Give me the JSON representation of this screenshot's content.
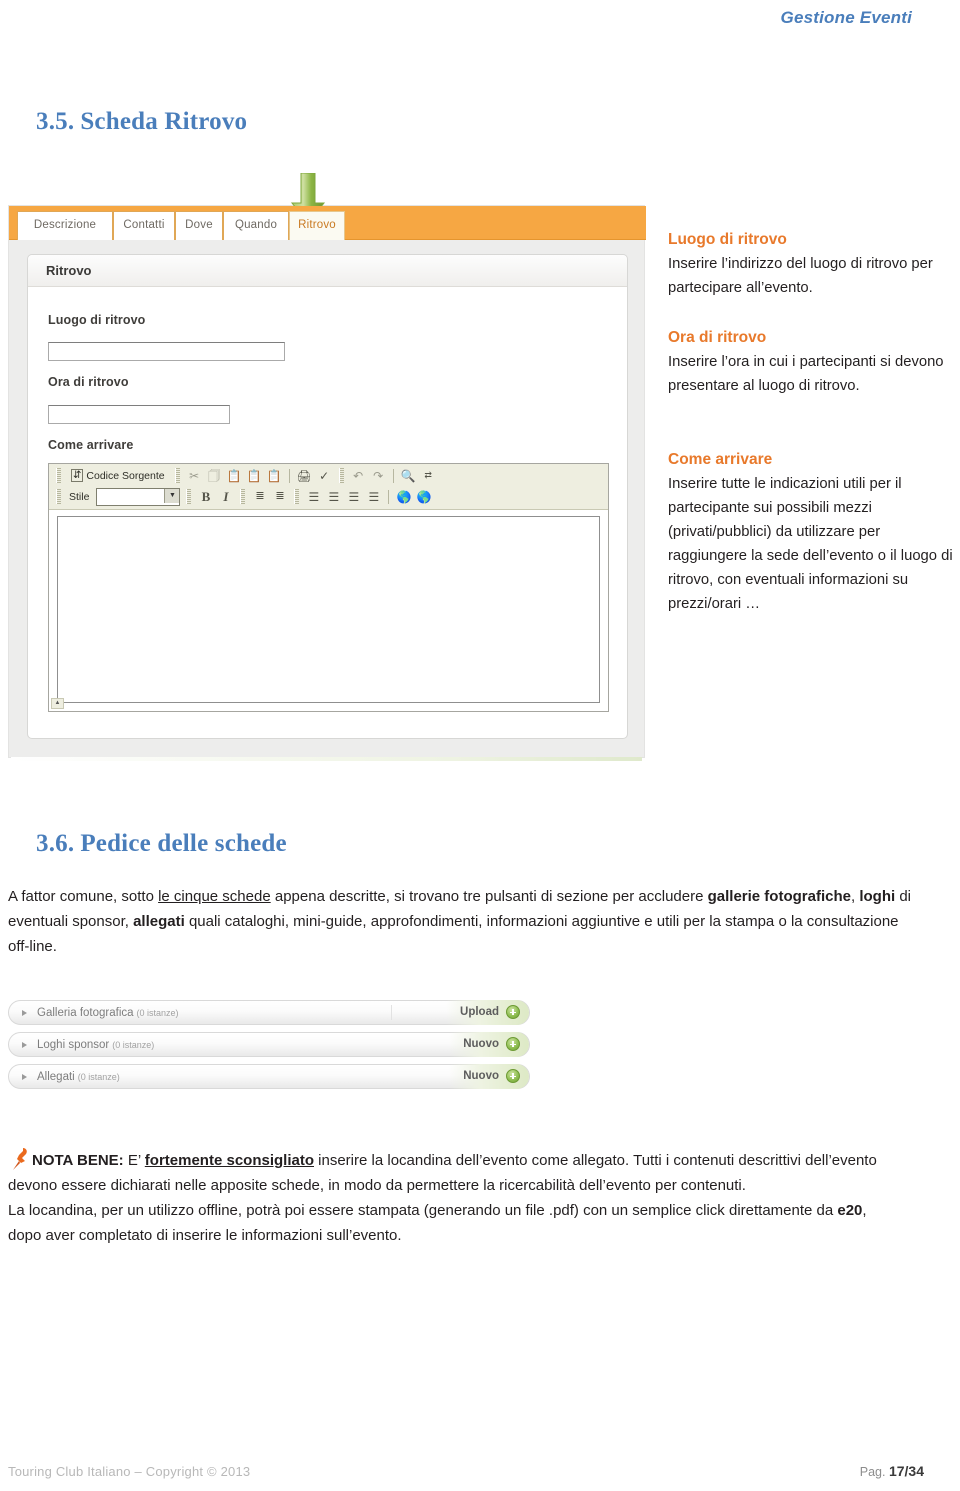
{
  "header": {
    "running_title": "Gestione Eventi"
  },
  "sections": {
    "s35": {
      "number": "3.5.",
      "title": "Scheda Ritrovo"
    },
    "s36": {
      "number": "3.6.",
      "title": "Pedice delle schede"
    }
  },
  "screenshot_ritrovo": {
    "tabs": [
      {
        "label": "Descrizione",
        "active": false
      },
      {
        "label": "Contatti",
        "active": false
      },
      {
        "label": "Dove",
        "active": false
      },
      {
        "label": "Quando",
        "active": false
      },
      {
        "label": "Ritrovo",
        "active": true
      }
    ],
    "panel_title": "Ritrovo",
    "fields": [
      {
        "label": "Luogo di ritrovo",
        "value": ""
      },
      {
        "label": "Ora di ritrovo",
        "value": ""
      },
      {
        "label": "Come arrivare",
        "value": ""
      }
    ],
    "editor": {
      "source_button": "Codice Sorgente",
      "style_label": "Stile",
      "style_value": "",
      "row1_icons": [
        "source-icon",
        "cut-icon",
        "copy-icon",
        "paste-icon",
        "paste-text-icon",
        "paste-word-icon",
        "print-icon",
        "spellcheck-icon",
        "undo-icon",
        "redo-icon",
        "find-icon",
        "replace-icon"
      ],
      "row2_icons": [
        "bold-icon",
        "italic-icon",
        "numbered-list-icon",
        "bulleted-list-icon",
        "align-left-icon",
        "align-center-icon",
        "align-right-icon",
        "align-justify-icon",
        "link-icon",
        "unlink-icon"
      ]
    }
  },
  "descriptions": [
    {
      "heading": "Luogo di ritrovo",
      "body": "Inserire l’indirizzo del luogo di ritrovo per partecipare all’evento."
    },
    {
      "heading": "Ora di ritrovo",
      "body": "Inserire l’ora in cui i partecipanti si devono presentare al luogo di ritrovo."
    },
    {
      "heading": "Come arrivare",
      "body": "Inserire tutte le indicazioni utili per il partecipante sui possibili mezzi (privati/pubblici) da utilizzare per raggiungere la sede dell’evento o il luogo di ritrovo, con eventuali informazioni su prezzi/orari …"
    }
  ],
  "paragraph_36": {
    "p1": "A fattor comune, sotto ",
    "u1": "le cinque schede",
    "p2": " appena descritte, si trovano tre pulsanti di sezione per accludere ",
    "b1": "gallerie fotografiche",
    "p3": ", ",
    "b2": "loghi",
    "p4": " di eventuali sponsor, ",
    "b3": "allegati",
    "p5": " quali cataloghi, mini-guide, approfondimenti, informazioni aggiuntive e utili per la stampa o la consultazione off-line."
  },
  "screenshot_accordion": {
    "rows": [
      {
        "label": "Galleria fotografica",
        "count": "(0 istanze)",
        "action": "Upload",
        "icon": "add-circle-icon"
      },
      {
        "label": "Loghi sponsor",
        "count": "(0 istanze)",
        "action": "Nuovo",
        "icon": "add-circle-icon"
      },
      {
        "label": "Allegati",
        "count": "(0 istanze)",
        "action": "Nuovo",
        "icon": "add-circle-icon"
      }
    ]
  },
  "note": {
    "icon": "pushpin-icon",
    "label": "NOTA BENE:",
    "t1": " E’ ",
    "u1": "fortemente sconsigliato",
    "t2": " inserire la locandina dell’evento come allegato. Tutti i contenuti descrittivi dell’evento devono essere dichiarati nelle apposite schede, in modo da permettere la ricercabilità dell’evento per contenuti.",
    "t3": "La locandina, per un utilizzo offline, potrà poi essere stampata (generando un file .pdf) con un semplice click direttamente da ",
    "b1": "e20",
    "t4": ", dopo aver completato di inserire le informazioni sull’evento."
  },
  "footer": {
    "left": "Touring Club Italiano – Copyright © 2013",
    "right_prefix": "Pag. ",
    "page": "17/34"
  },
  "colors": {
    "heading_blue": "#4a7ebb",
    "accent_orange": "#e8792b",
    "tabbar_orange": "#f6a743",
    "green_arrow": "#8cb544"
  }
}
